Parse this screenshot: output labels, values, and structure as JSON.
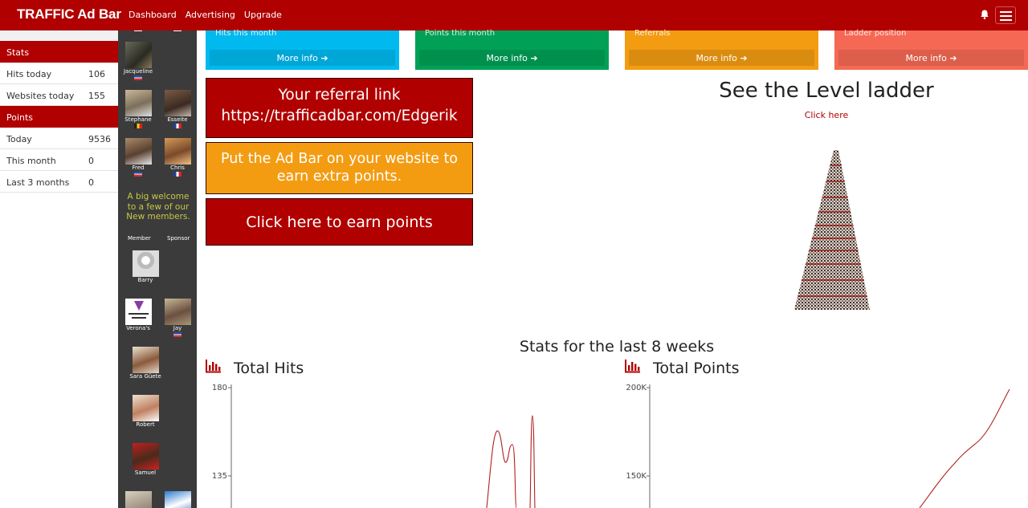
{
  "header": {
    "brand": "TRAFFIC Ad Bar",
    "nav": [
      "Dashboard",
      "Advertising",
      "Upgrade"
    ],
    "bg_color": "#b00000"
  },
  "sidebar": {
    "stats_title": "Stats",
    "hits_today_label": "Hits today",
    "hits_today": "106",
    "websites_today_label": "Websites today",
    "websites_today": "155",
    "points_title": "Points",
    "today_label": "Today",
    "today": "9536",
    "month_label": "This month",
    "month": "0",
    "three_months_label": "Last 3 months",
    "three_months": "0"
  },
  "members": {
    "top": [
      {
        "name": "Jacqueline"
      },
      {
        "name": "Stephane"
      },
      {
        "name": "Esseite"
      },
      {
        "name": "Fred"
      },
      {
        "name": "Chris"
      }
    ],
    "welcome": "A big welcome to a few of our New members.",
    "member_col": "Member",
    "sponsor_col": "Sponsor",
    "new": [
      {
        "name": "Barry"
      },
      {
        "name": "Verona's"
      },
      {
        "name": "Jay"
      },
      {
        "name": "Sara Güete"
      },
      {
        "name": "Robert"
      },
      {
        "name": "Samuel"
      }
    ]
  },
  "info_boxes": [
    {
      "title": "Hits this month",
      "more": "More info",
      "color": "#00b9ef"
    },
    {
      "title": "Points this month",
      "more": "More info",
      "color": "#00a157"
    },
    {
      "title": "Referrals",
      "more": "More info",
      "color": "#f39c12"
    },
    {
      "title": "Ladder position",
      "more": "More info",
      "color": "#f56954"
    }
  ],
  "referral": {
    "line1": "Your referral link",
    "line2": "https://trafficadbar.com/Edgerik"
  },
  "adbar_promo": {
    "line1": "Put the Ad Bar on your website to",
    "line2": "earn extra points."
  },
  "earn_button": "Click here to earn points",
  "ladder": {
    "title": "See the Level ladder",
    "link": "Click here"
  },
  "stats": {
    "title": "Stats for the last 8 weeks",
    "hits_title": "Total Hits",
    "points_title": "Total Points",
    "hits_ticks": [
      "180",
      "135"
    ],
    "points_ticks": [
      "200K",
      "150K"
    ]
  }
}
